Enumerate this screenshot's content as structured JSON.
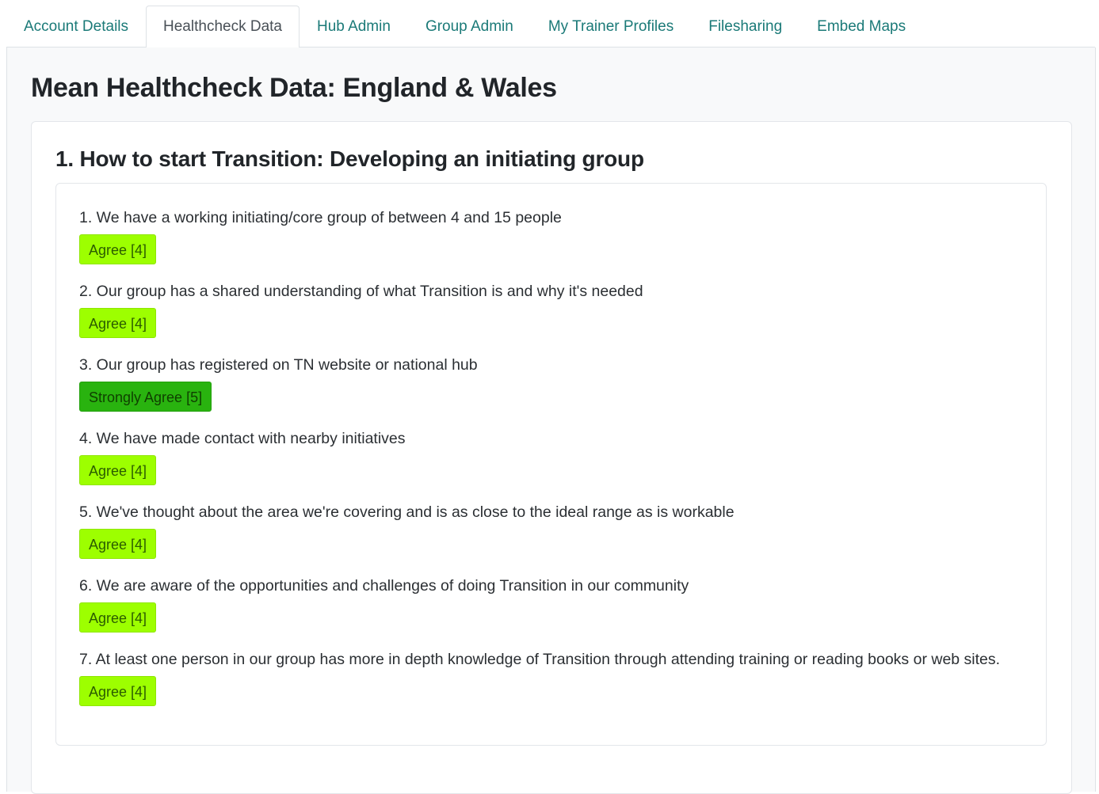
{
  "tabs": [
    {
      "label": "Account Details",
      "active": false
    },
    {
      "label": "Healthcheck Data",
      "active": true
    },
    {
      "label": "Hub Admin",
      "active": false
    },
    {
      "label": "Group Admin",
      "active": false
    },
    {
      "label": "My Trainer Profiles",
      "active": false
    },
    {
      "label": "Filesharing",
      "active": false
    },
    {
      "label": "Embed Maps",
      "active": false
    }
  ],
  "page_title": "Mean Healthcheck Data: England & Wales",
  "section": {
    "title": "1. How to start Transition: Developing an initiating group",
    "questions": [
      {
        "text": "1. We have a working initiating/core group of between 4 and 15 people",
        "answer": "Agree [4]",
        "level": "agree"
      },
      {
        "text": "2. Our group has a shared understanding of what Transition is and why it's needed",
        "answer": "Agree [4]",
        "level": "agree"
      },
      {
        "text": "3. Our group has registered on TN website or national hub",
        "answer": "Strongly Agree [5]",
        "level": "strong"
      },
      {
        "text": "4. We have made contact with nearby initiatives",
        "answer": "Agree [4]",
        "level": "agree"
      },
      {
        "text": "5. We've thought about the area we're covering and is as close to the ideal range as is workable",
        "answer": "Agree [4]",
        "level": "agree"
      },
      {
        "text": "6. We are aware of the opportunities and challenges of doing Transition in our community",
        "answer": "Agree [4]",
        "level": "agree"
      },
      {
        "text": "7. At least one person in our group has more in depth knowledge of Transition through attending training or reading books or web sites.",
        "answer": "Agree [4]",
        "level": "agree"
      }
    ]
  },
  "colors": {
    "tab_link": "#1b7a78",
    "agree_badge": "#9dff00",
    "strongly_agree_badge": "#29b30f"
  }
}
